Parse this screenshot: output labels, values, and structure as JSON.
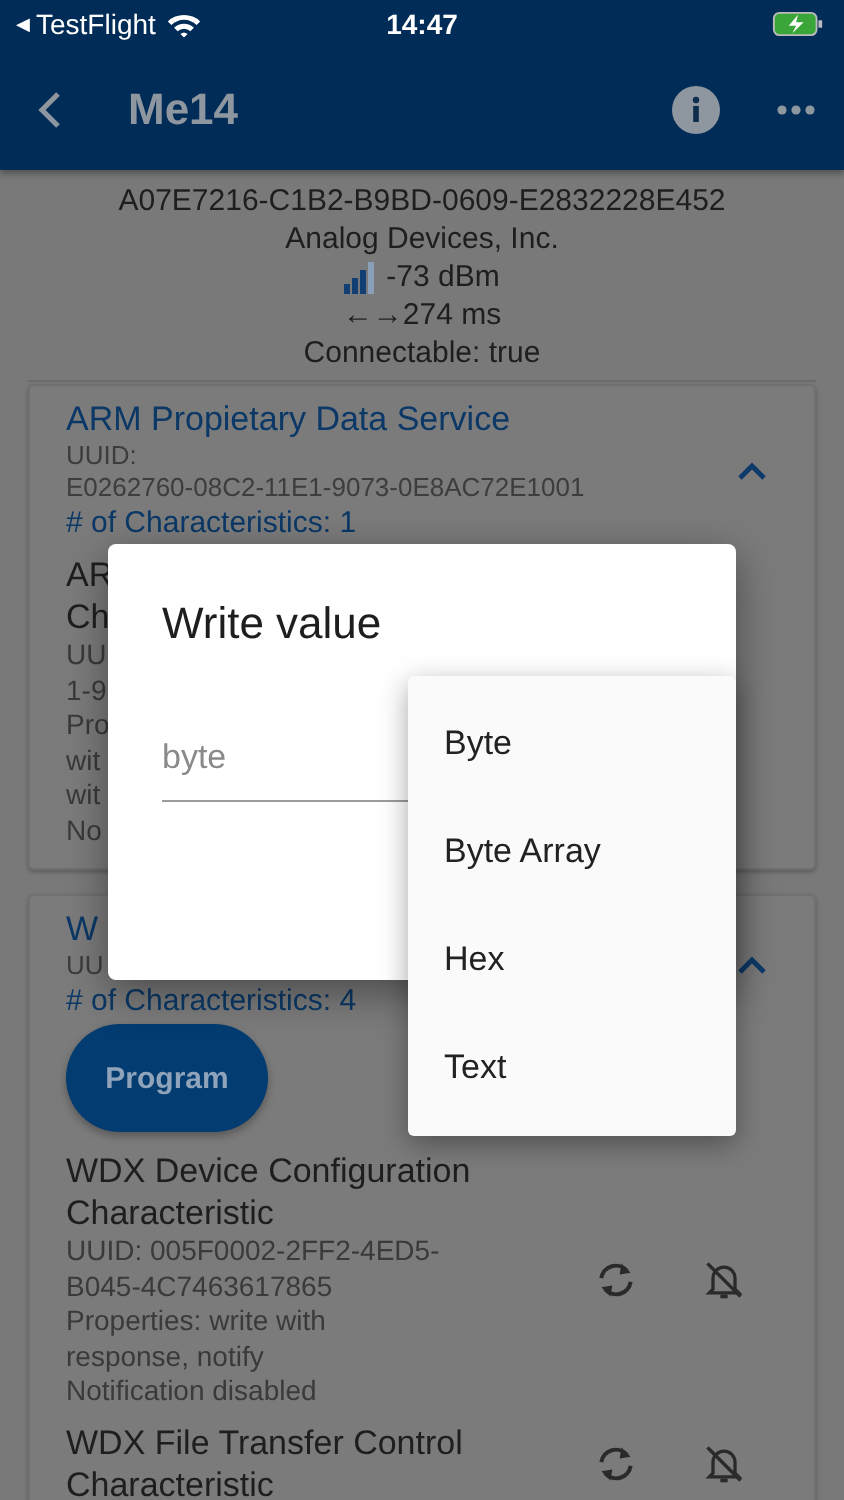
{
  "status_bar": {
    "back_glyph": "◀",
    "back_app": "TestFlight",
    "time": "14:47"
  },
  "app_bar": {
    "title": "Me14"
  },
  "device": {
    "uuid": "A07E7216-C1B2-B9BD-0609-E2832228E452",
    "manufacturer": "Analog Devices, Inc.",
    "rssi": "-73 dBm",
    "interval": "←→274 ms",
    "connectable": "Connectable: true"
  },
  "services": [
    {
      "name": "ARM Propietary Data Service",
      "uuid_lines": [
        "UUID:",
        "E0262760-08C2-11E1-9073-0E8AC72E1001"
      ],
      "count": "# of Characteristics: 1",
      "expanded": true,
      "characteristics": [
        {
          "kind": "fragment",
          "name_lines": [
            "AR",
            "Ch"
          ],
          "detail_lines": [
            "UU",
            "1-9",
            "Pro",
            "wit",
            "wit",
            "No"
          ]
        }
      ]
    },
    {
      "name": "W",
      "uuid_lines": [
        "UU"
      ],
      "count": "# of Characteristics: 4",
      "expanded": true,
      "button": "Program",
      "characteristics": [
        {
          "kind": "full",
          "name": "WDX Device Configuration Characteristic",
          "detail_lines": [
            "UUID: 005F0002-2FF2-4ED5-B045-4C7463617865",
            "Properties: write with response, notify",
            "Notification disabled"
          ]
        },
        {
          "kind": "full",
          "name": "WDX File Transfer Control Characteristic"
        }
      ]
    }
  ],
  "dialog": {
    "title": "Write value",
    "field": {
      "placeholder": "byte"
    },
    "menu": [
      {
        "label": "Byte"
      },
      {
        "label": "Byte Array"
      },
      {
        "label": "Hex"
      },
      {
        "label": "Text"
      }
    ]
  }
}
